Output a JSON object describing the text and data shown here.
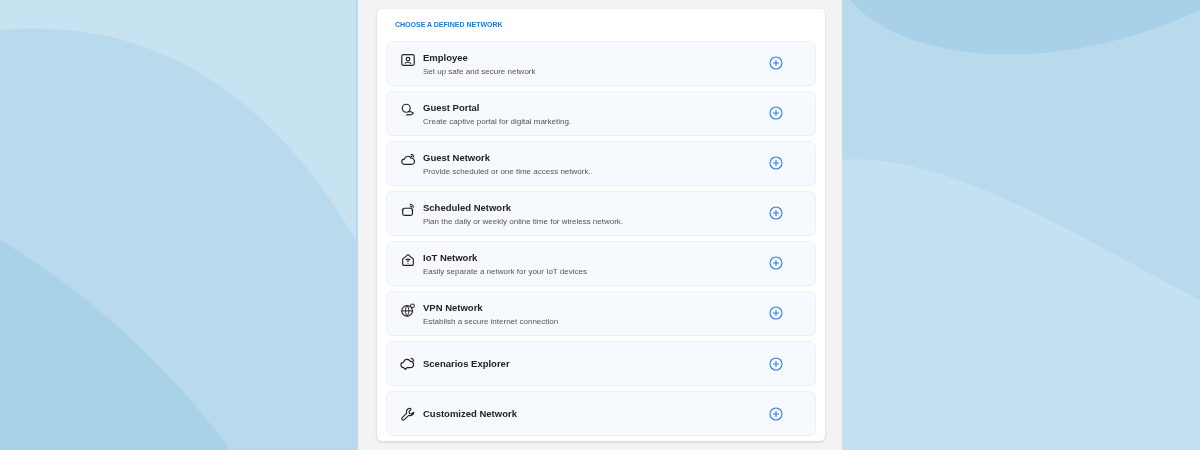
{
  "section_title": "CHOOSE A DEFINED NETWORK",
  "networks": [
    {
      "title": "Employee",
      "description": "Set up safe and secure network"
    },
    {
      "title": "Guest Portal",
      "description": "Create captive portal for digital marketing."
    },
    {
      "title": "Guest Network",
      "description": "Provide scheduled or one time access network.."
    },
    {
      "title": "Scheduled Network",
      "description": "Plan the daily or weekly online time for wireless network."
    },
    {
      "title": "IoT Network",
      "description": "Easily separate a network for your IoT devices"
    },
    {
      "title": "VPN Network",
      "description": "Establish a secure internet connection"
    },
    {
      "title": "Scenarios Explorer"
    },
    {
      "title": "Customized Network"
    }
  ]
}
